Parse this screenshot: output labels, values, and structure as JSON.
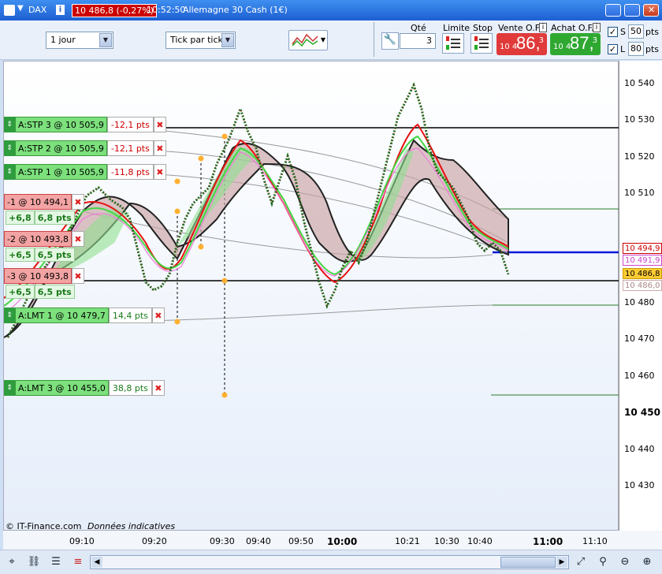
{
  "titlebar": {
    "instrument": "DAX",
    "quote": "10 486,8 (-0,27%)",
    "time": "10:52:50",
    "product": "Allemagne 30 Cash (1€)"
  },
  "toolbar": {
    "period": "1 jour",
    "tick_mode": "Tick par tick",
    "qty_label": "Qté",
    "qty_value": "3",
    "limit_label": "Limite",
    "stop_label": "Stop",
    "sell_label": "Vente O.F.",
    "buy_label": "Achat O.F.",
    "sell_small": "10 4",
    "sell_big": "86,",
    "sell_sup": "3",
    "buy_small": "10 4",
    "buy_big": "87,",
    "buy_sup": "3",
    "s_label": "S",
    "s_value": "50",
    "l_label": "L",
    "l_value": "80",
    "pts_label": "pts"
  },
  "orders": [
    {
      "label": "A:STP 3 @ 10 505,9",
      "pts": "-12,1 pts"
    },
    {
      "label": "A:STP 2 @ 10 505,9",
      "pts": "-12,1 pts"
    },
    {
      "label": "A:STP 1 @ 10 505,9",
      "pts": "-11,8 pts"
    },
    {
      "label": "-1 @ 10 494,1",
      "sub1": "+6,8",
      "sub2": "6,8 pts"
    },
    {
      "label": "-2 @ 10 493,8",
      "sub1": "+6,5",
      "sub2": "6,5 pts"
    },
    {
      "label": "-3 @ 10 493,8",
      "sub1": "+6,5",
      "sub2": "6,5 pts"
    },
    {
      "label": "A:LMT 1 @ 10 479,7",
      "pts": "14,4 pts"
    },
    {
      "label": "A:LMT 3 @ 10 455,0",
      "pts": "38,8 pts"
    }
  ],
  "yaxis": {
    "ticks": [
      "10 540",
      "10 530",
      "10 520",
      "10 510",
      "10 480",
      "10 470",
      "10 460",
      "10 450",
      "10 440",
      "10 430"
    ],
    "tags": [
      "10 494,9",
      "10 491,9",
      "10 486,8",
      "10 486,0"
    ]
  },
  "xaxis": {
    "ticks": [
      "09:10",
      "09:20",
      "09:30",
      "09:40",
      "09:50",
      "10:00",
      "10:21",
      "10:30",
      "10:40",
      "11:00",
      "11:10"
    ]
  },
  "footer": {
    "copyright": "© IT-Finance.com",
    "note": "Données indicatives"
  },
  "colors": {
    "sell": "#e03a3a",
    "buy": "#2fa832",
    "position_line": "#0018d8",
    "band_up": "#8fe08f",
    "band_down": "#c98f92"
  }
}
